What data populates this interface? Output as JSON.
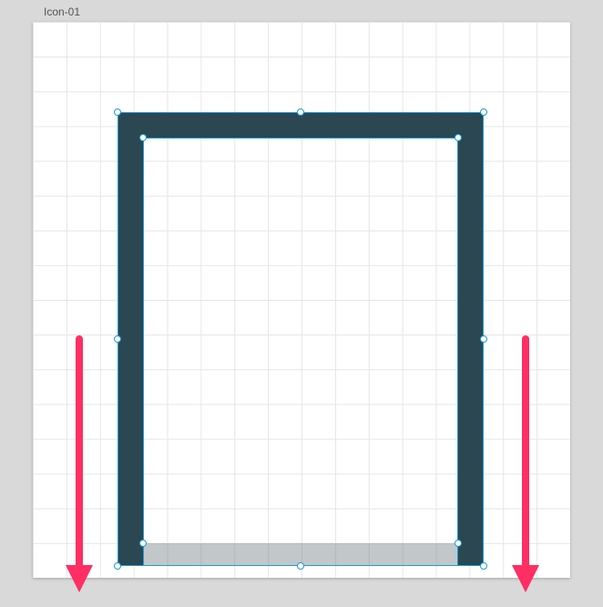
{
  "frame": {
    "label": "Icon-01"
  },
  "colors": {
    "shape_stroke": "#2a4752",
    "selection": "#1e9bd5",
    "annotation": "#ff2e63",
    "grid": "#e6e6e6",
    "bg": "#d9d9d9"
  }
}
